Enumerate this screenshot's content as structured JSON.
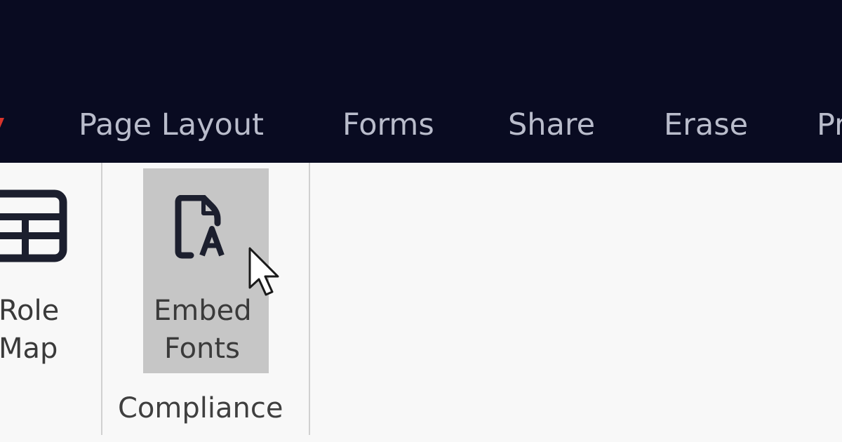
{
  "tabs": [
    {
      "label": "Page Layout"
    },
    {
      "label": "Forms"
    },
    {
      "label": "Share"
    },
    {
      "label": "Erase"
    },
    {
      "label": "Pr"
    }
  ],
  "ribbon": {
    "role_map": {
      "line1": "Role",
      "line2": "Map",
      "icon": "table-grid-icon"
    },
    "embed_fonts": {
      "line1": "Embed",
      "line2": "Fonts",
      "icon": "font-document-icon"
    },
    "group_label": "Compliance"
  },
  "colors": {
    "topbar_bg": "#090b21",
    "tab_text": "#b9bccb",
    "ribbon_bg": "#f8f8f8",
    "hover_bg": "#c6c6c6",
    "accent_marker": "#d9342b"
  }
}
